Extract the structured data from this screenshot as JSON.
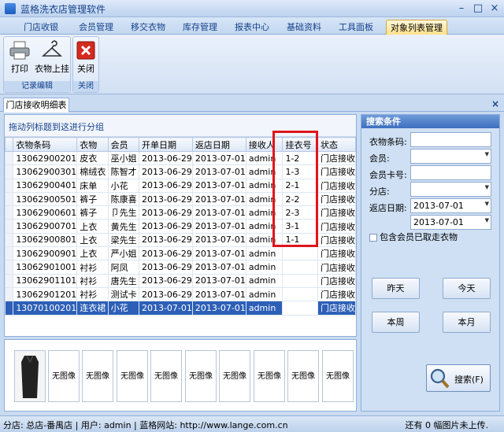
{
  "window": {
    "title": "蓝格洗衣店管理软件"
  },
  "menu": {
    "tabs": [
      "门店收银",
      "会员管理",
      "移交衣物",
      "库存管理",
      "报表中心",
      "基础资料",
      "工具面板",
      "对象列表管理"
    ],
    "active_index": 7
  },
  "ribbon": {
    "groups": [
      {
        "label": "记录编辑",
        "buttons": [
          {
            "label": "打印",
            "icon": "printer-icon"
          },
          {
            "label": "衣物上挂",
            "icon": "hanger-icon"
          }
        ]
      },
      {
        "label": "关闭",
        "buttons": [
          {
            "label": "关闭",
            "icon": "close-red-icon"
          }
        ]
      }
    ]
  },
  "doc_tab": {
    "label": "门店接收明细表"
  },
  "grid": {
    "group_hint": "拖动列标题到这进行分组",
    "columns": [
      "衣物条码",
      "衣物",
      "会员",
      "开单日期",
      "返店日期",
      "接收人",
      "挂衣号",
      "状态"
    ],
    "rows": [
      [
        "13062900201",
        "皮衣",
        "巫小姐",
        "2013-06-29",
        "2013-07-01",
        "admin",
        "1-2",
        "门店接收"
      ],
      [
        "13062900301",
        "棉绒衣",
        "陈智才",
        "2013-06-29",
        "2013-07-01",
        "admin",
        "1-3",
        "门店接收"
      ],
      [
        "13062900401",
        "床单",
        "小花",
        "2013-06-29",
        "2013-07-01",
        "admin",
        "2-1",
        "门店接收"
      ],
      [
        "13062900501",
        "裤子",
        "陈康喜",
        "2013-06-29",
        "2013-07-01",
        "admin",
        "2-2",
        "门店接收"
      ],
      [
        "13062900601",
        "裤子",
        "卩先生",
        "2013-06-29",
        "2013-07-01",
        "admin",
        "2-3",
        "门店接收"
      ],
      [
        "13062900701",
        "上衣",
        "黄先生",
        "2013-06-29",
        "2013-07-01",
        "admin",
        "3-1",
        "门店接收"
      ],
      [
        "13062900801",
        "上衣",
        "梁先生",
        "2013-06-29",
        "2013-07-01",
        "admin",
        "1-1",
        "门店接收"
      ],
      [
        "13062900901",
        "上衣",
        "严小姐",
        "2013-06-29",
        "2013-07-01",
        "admin",
        "",
        "门店接收"
      ],
      [
        "13062901001",
        "衬衫",
        "阿凤",
        "2013-06-29",
        "2013-07-01",
        "admin",
        "",
        "门店接收"
      ],
      [
        "13062901101",
        "衬衫",
        "唐先生",
        "2013-06-29",
        "2013-07-01",
        "admin",
        "",
        "门店接收"
      ],
      [
        "13062901201",
        "衬衫",
        "测试卡",
        "2013-06-29",
        "2013-07-01",
        "admin",
        "",
        "门店接收"
      ],
      [
        "13070100201",
        "连衣裙",
        "小花",
        "2013-07-01",
        "2013-07-01",
        "admin",
        "",
        "门店接收"
      ]
    ],
    "selected_row": 11
  },
  "images": {
    "no_image_label": "无图像",
    "count": 10
  },
  "search": {
    "header": "搜索条件",
    "fields": [
      {
        "label": "衣物条码:",
        "value": "",
        "dropdown": false
      },
      {
        "label": "会员:",
        "value": "",
        "dropdown": true
      },
      {
        "label": "会员卡号:",
        "value": "",
        "dropdown": false
      },
      {
        "label": "分店:",
        "value": "",
        "dropdown": true
      },
      {
        "label": "返店日期:",
        "value": "2013-07-01",
        "dropdown": true
      },
      {
        "label": "",
        "value": "2013-07-01",
        "dropdown": true
      }
    ],
    "checkbox_label": "包含会员已取走衣物",
    "btn_yesterday": "昨天",
    "btn_today": "今天",
    "btn_week": "本周",
    "btn_month": "本月",
    "btn_search": "搜索(F)"
  },
  "status": {
    "left": "分店: 总店-番禺店 | 用户: admin | 蓝格网站: http://www.lange.com.cn",
    "right": "还有 0 幅图片未上传."
  },
  "colors": {
    "highlight_box": "#e0151b",
    "selected_row": "#2d5fb7"
  }
}
